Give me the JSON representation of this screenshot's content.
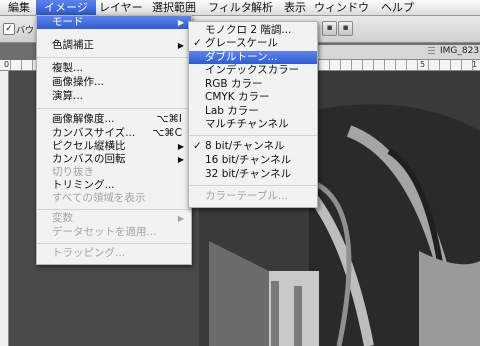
{
  "menubar": [
    "編集",
    "イメージ",
    "レイヤー",
    "選択範囲",
    "フィルタ",
    "解析",
    "表示",
    "ウィンドウ",
    "ヘルプ"
  ],
  "options": {
    "checkbox_label": "バウ"
  },
  "document": {
    "tab_title": "IMG_823"
  },
  "ruler": {
    "numbers": [
      "0",
      "5",
      "1"
    ]
  },
  "image_menu": {
    "items": [
      {
        "label": "モード",
        "highlighted": true,
        "submenu": true
      },
      {
        "label": "色調補正",
        "submenu": true
      },
      {
        "label": "複製..."
      },
      {
        "label": "画像操作..."
      },
      {
        "label": "演算..."
      },
      {
        "label": "画像解像度...",
        "shortcut": "⌥⌘I"
      },
      {
        "label": "カンバスサイズ...",
        "shortcut": "⌥⌘C"
      },
      {
        "label": "ピクセル縦横比",
        "submenu": true
      },
      {
        "label": "カンバスの回転",
        "submenu": true
      },
      {
        "label": "切り抜き",
        "disabled": true
      },
      {
        "label": "トリミング..."
      },
      {
        "label": "すべての領域を表示",
        "disabled": true
      },
      {
        "label": "変数",
        "disabled": true,
        "submenu": true
      },
      {
        "label": "データセットを適用...",
        "disabled": true
      },
      {
        "label": "トラッピング...",
        "disabled": true
      }
    ]
  },
  "mode_submenu": {
    "items": [
      {
        "label": "モノクロ 2 階調..."
      },
      {
        "label": "グレースケール",
        "checked": true
      },
      {
        "label": "ダブルトーン...",
        "highlighted": true
      },
      {
        "label": "インデックスカラー"
      },
      {
        "label": "RGB カラー"
      },
      {
        "label": "CMYK カラー"
      },
      {
        "label": "Lab カラー"
      },
      {
        "label": "マルチチャンネル"
      },
      {
        "label": "8 bit/チャンネル",
        "checked": true
      },
      {
        "label": "16 bit/チャンネル"
      },
      {
        "label": "32 bit/チャンネル"
      },
      {
        "label": "カラーテーブル...",
        "disabled": true
      }
    ]
  },
  "icons": {
    "checkmark": "✓",
    "submenu_arrow": "▶"
  }
}
